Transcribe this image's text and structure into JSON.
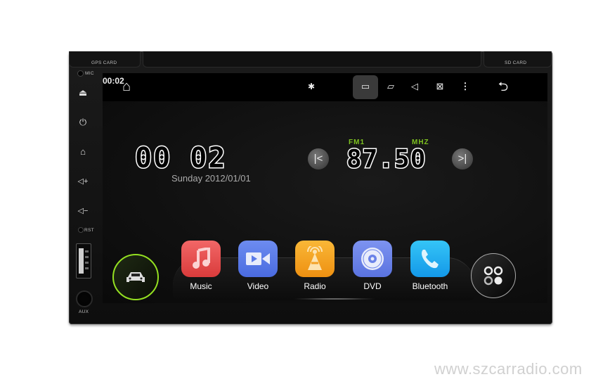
{
  "device": {
    "labels": {
      "gps_card": "GPS CARD",
      "sd_card": "SD CARD",
      "mic": "MIC",
      "rst": "RST",
      "aux": "AUX"
    },
    "side_buttons": [
      {
        "name": "eject",
        "glyph": "⏏"
      },
      {
        "name": "power",
        "glyph": "⏻"
      },
      {
        "name": "home",
        "glyph": "⌂"
      },
      {
        "name": "volume-up",
        "glyph": "◁+"
      },
      {
        "name": "volume-down",
        "glyph": "◁−"
      }
    ]
  },
  "statusbar": {
    "home_icon": "⌂",
    "bluetooth_icon": "✱",
    "time": "00:02",
    "screenshot_icon": "▭",
    "recent_apps_icon": "▱",
    "volume_icon": "◁",
    "screen_off_icon": "⊠",
    "more_icon": "⋮",
    "back_icon": "⮌"
  },
  "clock": {
    "time": "00 02",
    "date": "Sunday 2012/01/01"
  },
  "radio": {
    "band": "FM1",
    "unit": "MHZ",
    "frequency": "87.50",
    "prev_glyph": "|<",
    "next_glyph": ">|"
  },
  "apps": [
    {
      "label": "Music",
      "color": "#e54b4b"
    },
    {
      "label": "Video",
      "color": "#5a7ae8"
    },
    {
      "label": "Radio",
      "color": "#f3a124"
    },
    {
      "label": "DVD",
      "color": "#6a82e8"
    },
    {
      "label": "Bluetooth",
      "color": "#22afef"
    }
  ],
  "car_button": {
    "accent": "#94e021"
  },
  "watermark": "www.szcarradio.com"
}
